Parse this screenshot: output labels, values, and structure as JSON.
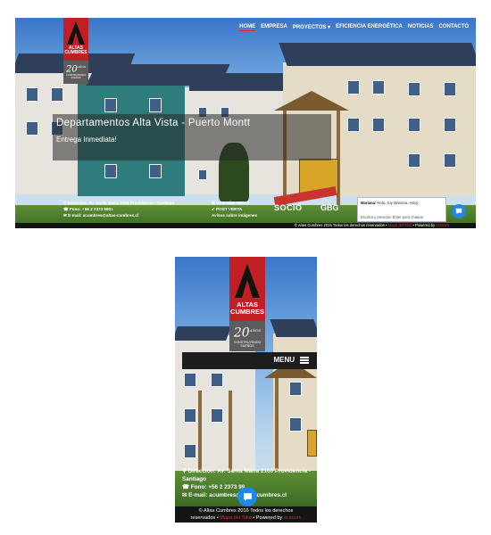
{
  "desktop": {
    "nav": [
      {
        "label": "HOME",
        "active": true
      },
      {
        "label": "EMPRESA",
        "active": false
      },
      {
        "label": "PROYECTOS ▾",
        "active": false
      },
      {
        "label": "EFICIENCIA ENERGÉTICA",
        "active": false
      },
      {
        "label": "NOTICIAS",
        "active": false
      },
      {
        "label": "CONTACTO",
        "active": false
      }
    ],
    "logo": {
      "line1": "ALTAS",
      "line2": "CUMBRES"
    },
    "badge": {
      "number": "20",
      "sup": "AÑOS",
      "sub": "CONSTRUYENDO SUEÑOS"
    },
    "hero": {
      "title": "Departamentos Alta Vista - Puerto Montt",
      "subtitle": "Entrega Inmediata!"
    },
    "contact": {
      "address": "Dirección: Av. Santa María 2160 Providencia - Santiago",
      "phone": "Fono: +56 2 2373 9901",
      "email": "E-mail: acumbres@altas-cumbres.cl"
    },
    "links": {
      "gestion": "GESTIÓN VENTA",
      "postventa": "POST VENTA",
      "avisos": "Avisos sobre imágenes"
    },
    "brands": {
      "brand1": "SOCIO",
      "brand2": "GBG"
    },
    "chat": {
      "agent": "Mariana:",
      "greeting": "Hola, soy Mariana, estoy",
      "hint": "Escriba y presione Enter para chatear"
    },
    "footer": {
      "text": "© Altas Cumbres 2016 Todos los derechos reservados •",
      "map": "Mapa del Sitio",
      "powered": "• Powered by",
      "by": "ecsoum"
    }
  },
  "mobile": {
    "logo": {
      "line1": "ALTAS",
      "line2": "CUMBRES"
    },
    "badge": {
      "number": "20",
      "sup": "AÑOS",
      "sub": "CONSTRUYENDO SUEÑOS"
    },
    "menu_label": "MENU",
    "contact": {
      "address": "Dirección: Av. Santa María 2160 Providencia - Santiago",
      "phone": "Fono: +56 2 2373 99",
      "email": "E-mail: acumbres@altas-cumbres.cl"
    },
    "footer": {
      "line1": "© Altas Cumbres 2016 Todos los derechos",
      "line2a": "reservados •",
      "map": "Mapa del Sitio",
      "powered": "• Powered by",
      "by": "ecsoum"
    }
  },
  "colors": {
    "brand_red": "#c01f24",
    "chat_blue": "#1e88e5",
    "nav_active": "#e12b2b"
  }
}
